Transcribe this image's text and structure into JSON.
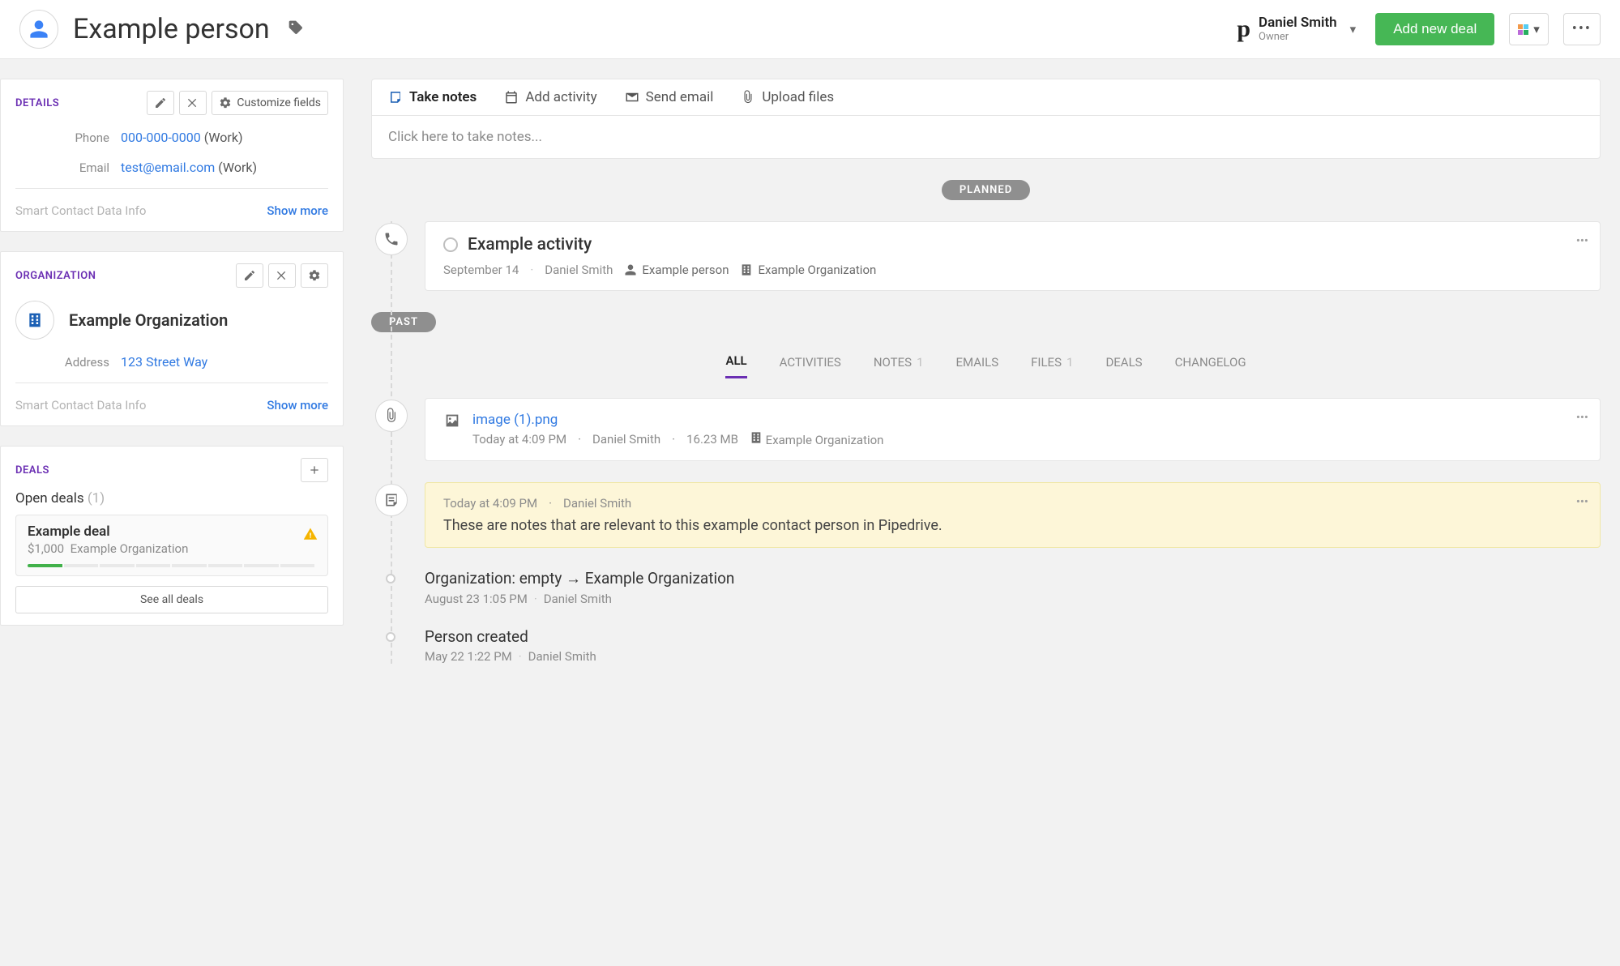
{
  "header": {
    "title": "Example person",
    "owner_name": "Daniel Smith",
    "owner_role": "Owner",
    "add_deal": "Add new deal"
  },
  "details": {
    "title": "DETAILS",
    "customize": "Customize fields",
    "phone_label": "Phone",
    "phone_value": "000-000-0000",
    "phone_suffix": "(Work)",
    "email_label": "Email",
    "email_value": "test@email.com",
    "email_suffix": "(Work)",
    "smart_label": "Smart Contact Data Info",
    "show_more": "Show more"
  },
  "organization": {
    "title": "ORGANIZATION",
    "name": "Example Organization",
    "address_label": "Address",
    "address_value": "123 Street Way",
    "smart_label": "Smart Contact Data Info",
    "show_more": "Show more"
  },
  "deals": {
    "title": "DEALS",
    "open_label": "Open deals",
    "open_count": "(1)",
    "item": {
      "name": "Example deal",
      "amount": "$1,000",
      "org": "Example Organization"
    },
    "see_all": "See all deals"
  },
  "compose": {
    "take_notes": "Take notes",
    "add_activity": "Add activity",
    "send_email": "Send email",
    "upload_files": "Upload files",
    "placeholder": "Click here to take notes..."
  },
  "sections": {
    "planned": "PLANNED",
    "past": "PAST"
  },
  "activity": {
    "title": "Example activity",
    "date": "September 14",
    "owner": "Daniel Smith",
    "person": "Example person",
    "org": "Example Organization"
  },
  "tabs": {
    "all": "ALL",
    "activities": "ACTIVITIES",
    "notes": "NOTES",
    "notes_count": "1",
    "emails": "EMAILS",
    "files": "FILES",
    "files_count": "1",
    "deals": "DEALS",
    "changelog": "CHANGELOG"
  },
  "file": {
    "name": "image (1).png",
    "time": "Today at 4:09 PM",
    "owner": "Daniel Smith",
    "size": "16.23 MB",
    "org": "Example Organization"
  },
  "note": {
    "time": "Today at 4:09 PM",
    "owner": "Daniel Smith",
    "text": "These are notes that are relevant to this example contact person in Pipedrive."
  },
  "change1": {
    "title": "Organization: empty → Example Organization",
    "time": "August 23 1:05 PM",
    "owner": "Daniel Smith"
  },
  "change2": {
    "title": "Person created",
    "time": "May 22 1:22 PM",
    "owner": "Daniel Smith"
  }
}
